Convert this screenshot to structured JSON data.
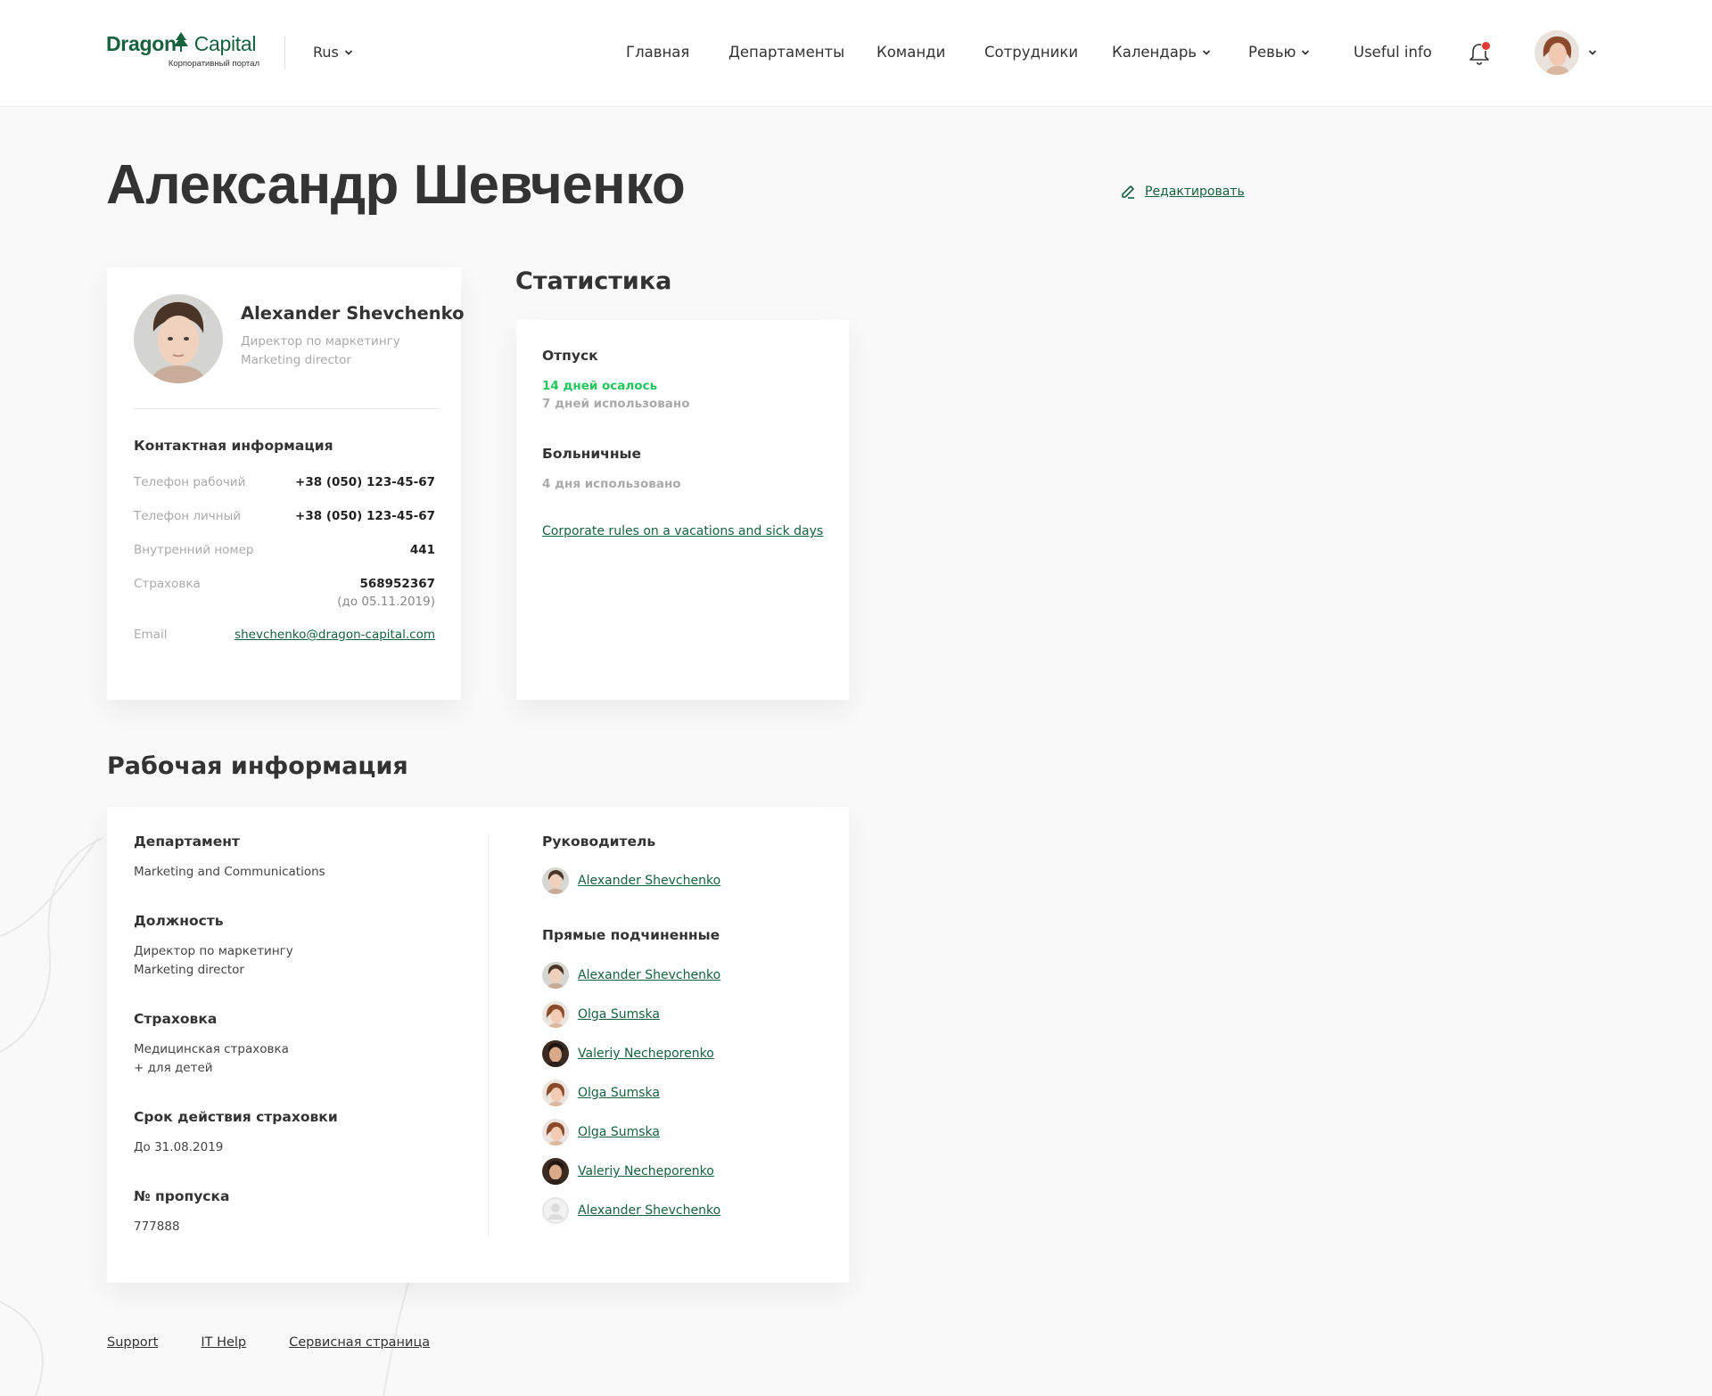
{
  "header": {
    "logo_brand_a": "Dragon",
    "logo_brand_b": "Capital",
    "logo_subtitle": "Корпоративный портал",
    "language": "Rus",
    "nav": [
      {
        "label": "Главная",
        "has_dropdown": false
      },
      {
        "label": "Департаменты",
        "has_dropdown": false
      },
      {
        "label": "Команди",
        "has_dropdown": false
      },
      {
        "label": "Сотрудники",
        "has_dropdown": false
      },
      {
        "label": "Календарь",
        "has_dropdown": true
      },
      {
        "label": "Ревью",
        "has_dropdown": true
      },
      {
        "label": "Useful info",
        "has_dropdown": false
      }
    ],
    "notification_unread": true
  },
  "page": {
    "title": "Александр Шевченко",
    "edit_label": "Редактировать"
  },
  "profile": {
    "name": "Alexander Shevchenko",
    "role_ru": "Директор по маркетингу",
    "role_en": "Marketing director",
    "contact_title": "Контактная информация",
    "contacts": {
      "work_phone_label": "Телефон рабочий",
      "work_phone": "+38 (050) 123-45-67",
      "personal_phone_label": "Телефон личный",
      "personal_phone": "+38 (050) 123-45-67",
      "ext_label": "Внутренний номер",
      "ext": "441",
      "insurance_label": "Страховка",
      "insurance": "568952367",
      "insurance_until": "(до 05.11.2019)",
      "email_label": "Email",
      "email": "shevchenko@dragon-capital.com"
    }
  },
  "stats": {
    "title": "Статистика",
    "vacation_title": "Отпуск",
    "vacation_left": "14 дней осалось",
    "vacation_used": "7 дней использовано",
    "sick_title": "Больничные",
    "sick_used": "4 дня использовано",
    "rules_link": "Corporate rules on a vacations and sick days"
  },
  "work": {
    "title": "Рабочая информация",
    "department_label": "Департамент",
    "department": "Marketing and Communications",
    "position_label": "Должность",
    "position_ru": "Директор по маркетингу",
    "position_en": "Marketing director",
    "insurance_label": "Страховка",
    "insurance_line1": "Медицинская страховка",
    "insurance_line2": "+ для детей",
    "insurance_term_label": "Срок действия страховки",
    "insurance_term": "До 31.08.2019",
    "pass_label": "№ пропуска",
    "pass": "777888",
    "manager_label": "Руководитель",
    "manager": {
      "name": "Alexander Shevchenko",
      "avatar": "man-light"
    },
    "reports_label": "Прямые подчиненные",
    "reports": [
      {
        "name": "Alexander Shevchenko",
        "avatar": "man-light"
      },
      {
        "name": "Olga Sumska",
        "avatar": "woman"
      },
      {
        "name": "Valeriy Necheporenko",
        "avatar": "man-dark"
      },
      {
        "name": "Olga Sumska",
        "avatar": "woman"
      },
      {
        "name": "Olga Sumska",
        "avatar": "woman"
      },
      {
        "name": "Valeriy Necheporenko",
        "avatar": "man-dark"
      },
      {
        "name": "Alexander Shevchenko",
        "avatar": "placeholder"
      }
    ]
  },
  "footer": {
    "links": [
      "Support",
      "IT Help",
      "Сервисная страница"
    ]
  },
  "colors": {
    "brand": "#17613f",
    "accent_green": "#22c55e",
    "notification": "#e53935",
    "background": "#f9f9f9"
  }
}
